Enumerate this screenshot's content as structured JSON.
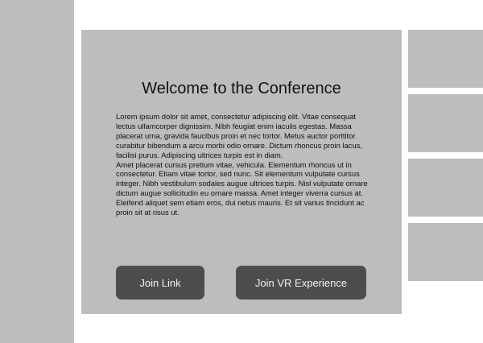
{
  "main": {
    "title": "Welcome to the Conference",
    "paragraph_1": "Lorem ipsum dolor sit amet, consectetur adipiscing elit. Vitae consequat lectus ullamcorper dignissim. Nibh feugiat enim iaculis egestas. Massa placerat urna, gravida faucibus proin et nec tortor. Metus auctor porttitor curabitur bibendum a arcu morbi odio ornare. Dictum rhoncus proin lacus, facilisi purus. Adipiscing ultrices turpis est in diam.",
    "paragraph_2": "Amet placerat cursus pretium vitae, vehicula. Elementum rhoncus ut in consectetur. Etiam vitae tortor, sed nunc. Sit elementum vulputate cursus integer. Nibh vestibulum sodales augue ultrices turpis. Nisl vulputate ornare dictum augue sollicitudin eu ornare massa. Amet integer viverra cursus at. Eleifend aliquet sem etiam eros, dui netus mauris. Et sit varius tincidunt ac proin sit at risus ut.",
    "join_link_label": "Join Link",
    "join_vr_label": "Join VR Experience"
  },
  "colors": {
    "background": "#ffffff",
    "panel": "#bdbdbd",
    "button": "#4d4d4d",
    "button_text": "#f2f2f2",
    "text": "#111111"
  }
}
